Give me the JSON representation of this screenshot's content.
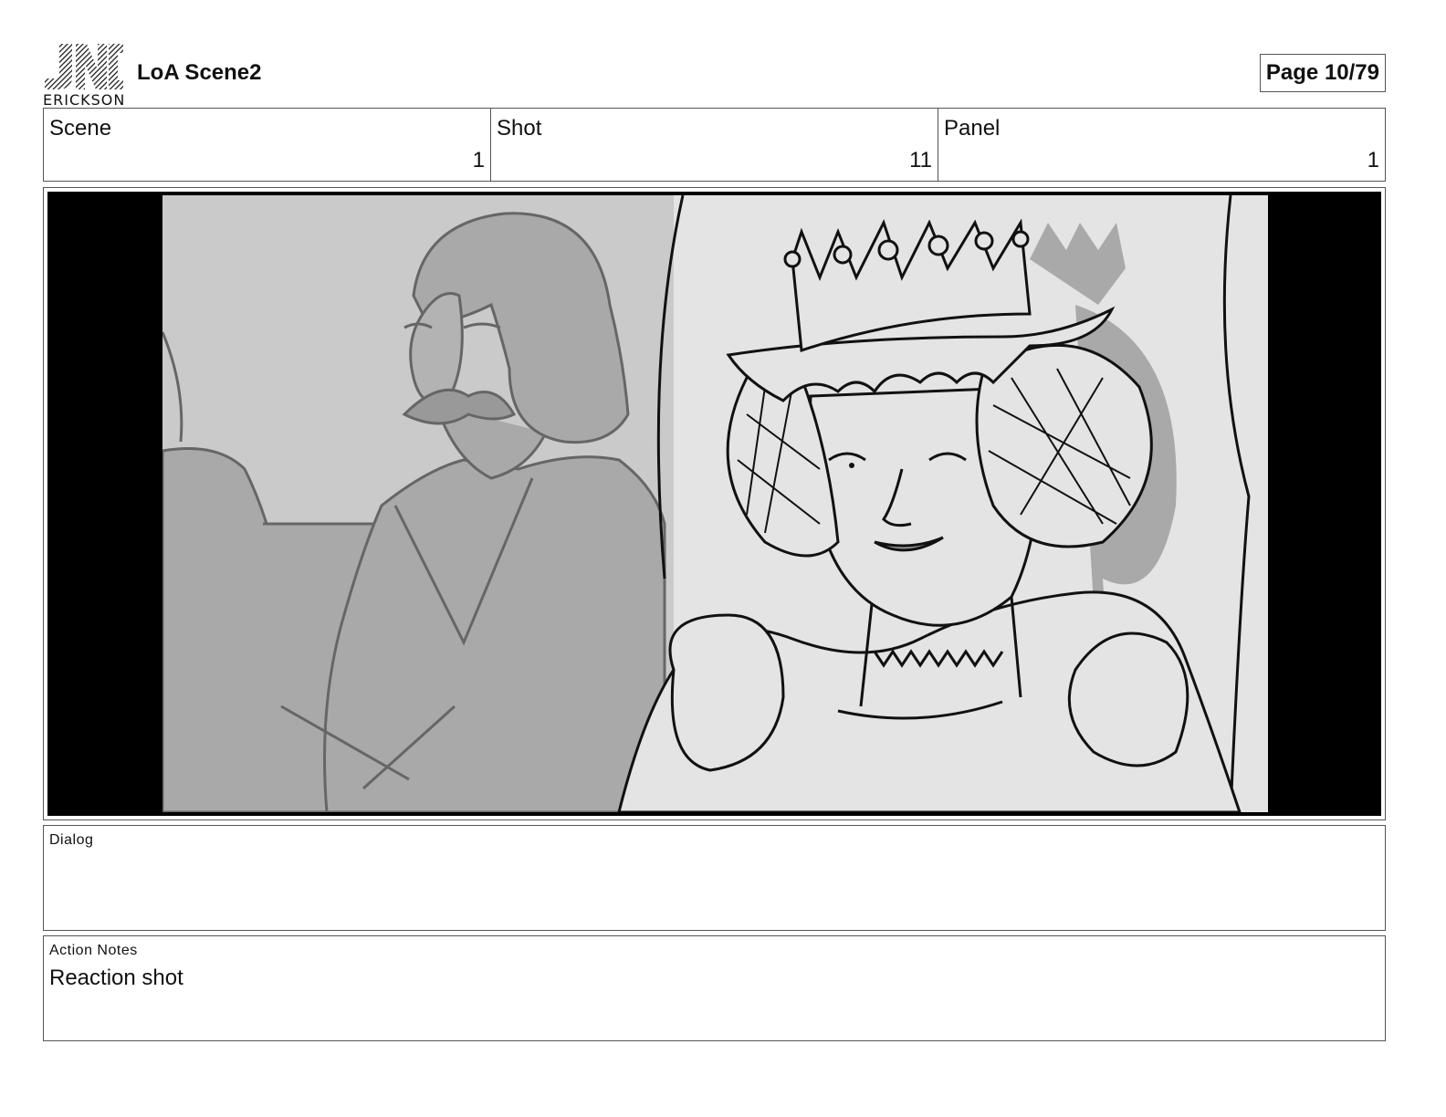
{
  "header": {
    "logo_text": "ERICKSON",
    "title": "LoA Scene2",
    "page_indicator": "Page 10/79"
  },
  "info": {
    "scene": {
      "label": "Scene",
      "value": "1"
    },
    "shot": {
      "label": "Shot",
      "value": "11"
    },
    "panel": {
      "label": "Panel",
      "value": "1"
    }
  },
  "dialog": {
    "label": "Dialog",
    "text": ""
  },
  "action_notes": {
    "label": "Action Notes",
    "text": "Reaction shot"
  },
  "colors": {
    "border": "#555555",
    "letterbox": "#000000",
    "sketch_bg": "#e4e4e4",
    "sketch_mid": "#a9a9a9"
  }
}
